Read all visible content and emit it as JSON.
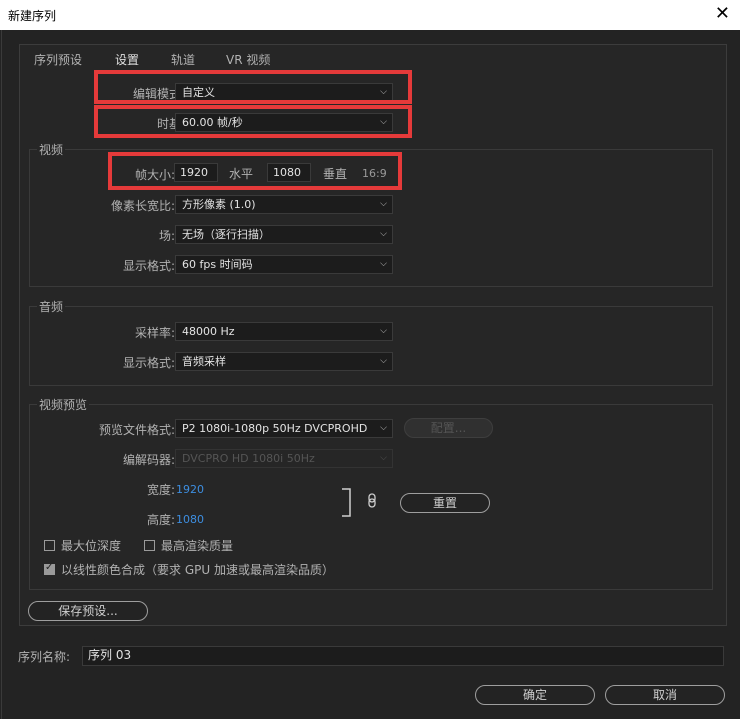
{
  "window": {
    "title": "新建序列",
    "close_glyph": "✕"
  },
  "tabs": [
    "序列预设",
    "设置",
    "轨道",
    "VR 视频"
  ],
  "editing": {
    "mode_label": "编辑模式:",
    "mode_value": "自定义",
    "timebase_label": "时基:",
    "timebase_value": "60.00  帧/秒"
  },
  "video": {
    "group_title": "视频",
    "frame_size_label": "帧大小:",
    "width": "1920",
    "horizontal_label": "水平",
    "height": "1080",
    "vertical_label": "垂直",
    "ratio": "16:9",
    "pixel_aspect_label": "像素长宽比:",
    "pixel_aspect_value": "方形像素 (1.0)",
    "fields_label": "场:",
    "fields_value": "无场（逐行扫描）",
    "display_format_label": "显示格式:",
    "display_format_value": "60 fps 时间码"
  },
  "audio": {
    "group_title": "音频",
    "sample_rate_label": "采样率:",
    "sample_rate_value": "48000 Hz",
    "display_format_label": "显示格式:",
    "display_format_value": "音频采样"
  },
  "preview": {
    "group_title": "视频预览",
    "file_format_label": "预览文件格式:",
    "file_format_value": "P2 1080i-1080p 50Hz DVCPROHD",
    "config_button": "配置...",
    "codec_label": "编解码器:",
    "codec_value": "DVCPRO HD 1080i 50Hz",
    "width_label": "宽度:",
    "width_value": "1920",
    "height_label": "高度:",
    "height_value": "1080",
    "reset_button": "重置",
    "max_bit_depth": "最大位深度",
    "max_render_quality": "最高渲染质量",
    "linear_color": "以线性颜色合成（要求 GPU 加速或最高渲染品质）",
    "max_bit_depth_checked": false,
    "max_render_quality_checked": false,
    "linear_color_checked": true
  },
  "save_preset_button": "保存预设...",
  "sequence_name_label": "序列名称:",
  "sequence_name_value": "序列 03",
  "ok_button": "确定",
  "cancel_button": "取消",
  "colors": {
    "highlight_box": "#e53a3a",
    "value_blue": "#3d8ee0",
    "background": "#232323"
  }
}
